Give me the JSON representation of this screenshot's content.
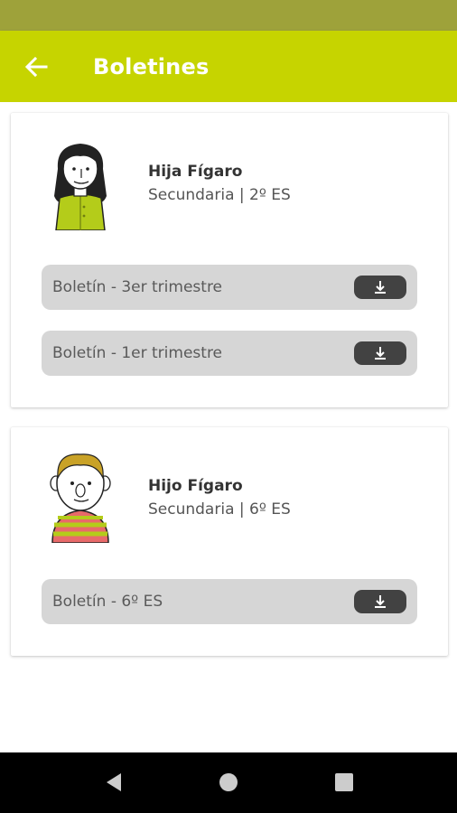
{
  "app": {
    "title": "Boletines",
    "back_icon": "arrow-left-icon",
    "colors": {
      "status_bar": "#9ea23a",
      "app_bar": "#c6d400",
      "bulletin_bg": "#d6d6d6",
      "download_bg": "#424242"
    }
  },
  "students": [
    {
      "name": "Hija Fígaro",
      "course": "Secundaria | 2º ES",
      "avatar": "girl-avatar",
      "bulletins": [
        {
          "label": "Boletín - 3er trimestre",
          "icon": "download-icon"
        },
        {
          "label": "Boletín - 1er trimestre",
          "icon": "download-icon"
        }
      ]
    },
    {
      "name": "Hijo Fígaro",
      "course": "Secundaria | 6º ES",
      "avatar": "boy-avatar",
      "bulletins": [
        {
          "label": "Boletín - 6º ES",
          "icon": "download-icon"
        }
      ]
    }
  ],
  "nav": {
    "back": "nav-back-icon",
    "home": "nav-home-icon",
    "recents": "nav-recents-icon"
  }
}
